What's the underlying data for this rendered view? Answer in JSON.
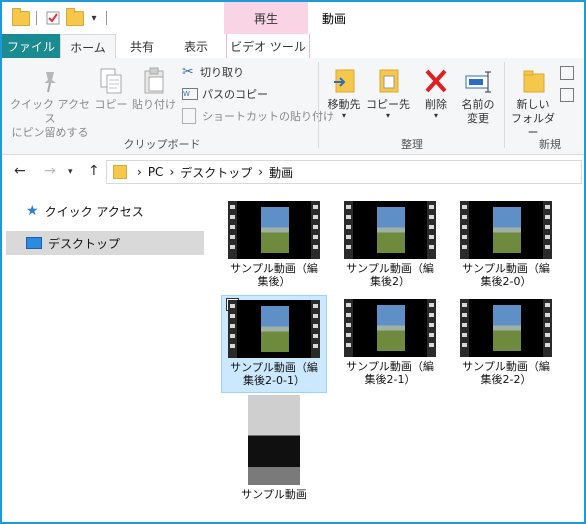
{
  "window": {
    "title": "動画",
    "context_tab": "再生"
  },
  "tabs": {
    "file": "ファイル",
    "home": "ホーム",
    "share": "共有",
    "view": "表示",
    "video_tools": "ビデオ ツール"
  },
  "ribbon": {
    "pin_quick_access_line1": "クイック アクセス",
    "pin_quick_access_line2": "にピン留めする",
    "copy": "コピー",
    "paste": "貼り付け",
    "cut": "切り取り",
    "copy_path": "パスのコピー",
    "paste_shortcut": "ショートカットの貼り付け",
    "clipboard_group": "クリップボード",
    "move_to": "移動先",
    "copy_to": "コピー先",
    "delete": "削除",
    "rename_line1": "名前の",
    "rename_line2": "変更",
    "organize_group": "整理",
    "new_folder_line1": "新しい",
    "new_folder_line2": "フォルダー",
    "new_group": "新規"
  },
  "address": {
    "crumbs": [
      "PC",
      "デスクトップ",
      "動画"
    ]
  },
  "sidebar": {
    "items": [
      {
        "label": "クイック アクセス"
      },
      {
        "label": "デスクトップ"
      }
    ]
  },
  "files": [
    {
      "line1": "サンプル動画（編",
      "line2": "集後）"
    },
    {
      "line1": "サンプル動画（編",
      "line2": "集後2）"
    },
    {
      "line1": "サンプル動画（編",
      "line2": "集後2-0）"
    },
    {
      "line1": "サンプル動画（編",
      "line2": "集後2-0-1）"
    },
    {
      "line1": "サンプル動画（編",
      "line2": "集後2-1）"
    },
    {
      "line1": "サンプル動画（編",
      "line2": "集後2-2）"
    },
    {
      "line1": "サンプル動画",
      "line2": ""
    }
  ],
  "colors": {
    "accent": "#1e9bd6",
    "file_tab": "#1a8b91",
    "context_tab": "#f8d4e4",
    "selection": "#cce8ff"
  }
}
